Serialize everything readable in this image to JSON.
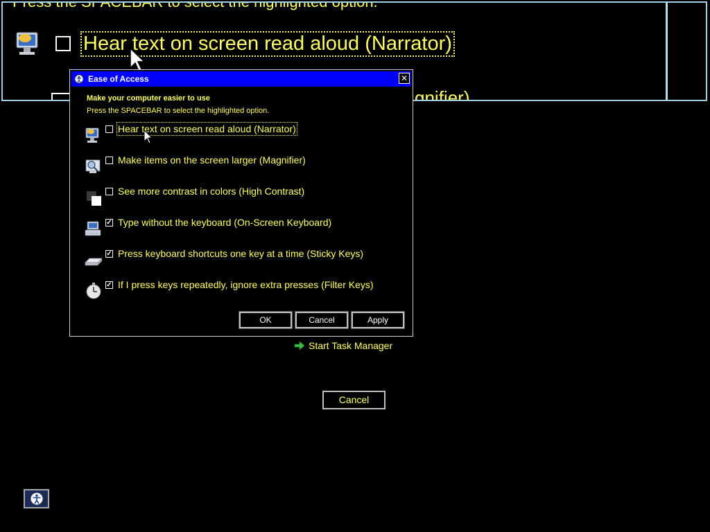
{
  "magnified": {
    "top_text": "Press the SPACEBAR to select the highlighted option.",
    "row1_label": "Hear text on screen read aloud (Narrator)",
    "row2_partial": "gnifier)"
  },
  "dialog": {
    "title": "Ease of Access",
    "close_symbol": "✕",
    "heading": "Make your computer easier to use",
    "subheading": "Press the SPACEBAR to select the highlighted option.",
    "options": [
      {
        "label": "Hear text on screen read aloud (Narrator)",
        "checked": false,
        "check_mark": "",
        "icon": "narrator-icon"
      },
      {
        "label": "Make items on the screen larger (Magnifier)",
        "checked": false,
        "check_mark": "",
        "icon": "magnifier-icon"
      },
      {
        "label": "See more contrast in colors (High Contrast)",
        "checked": false,
        "check_mark": "",
        "icon": "high-contrast-icon"
      },
      {
        "label": "Type without the keyboard (On-Screen Keyboard)",
        "checked": true,
        "check_mark": "✓",
        "icon": "keyboard-icon"
      },
      {
        "label": "Press keyboard shortcuts one key at a time (Sticky Keys)",
        "checked": true,
        "check_mark": "✓",
        "icon": "sticky-keys-icon"
      },
      {
        "label": "If I press keys repeatedly, ignore extra presses (Filter Keys)",
        "checked": true,
        "check_mark": "✓",
        "icon": "filter-keys-icon"
      }
    ],
    "buttons": {
      "ok": "OK",
      "cancel": "Cancel",
      "apply": "Apply"
    }
  },
  "logon": {
    "task_manager": "Start Task Manager",
    "cancel": "Cancel"
  },
  "colors": {
    "text": "#ffff66",
    "titlebar": "#0000ff",
    "background": "#000000"
  }
}
